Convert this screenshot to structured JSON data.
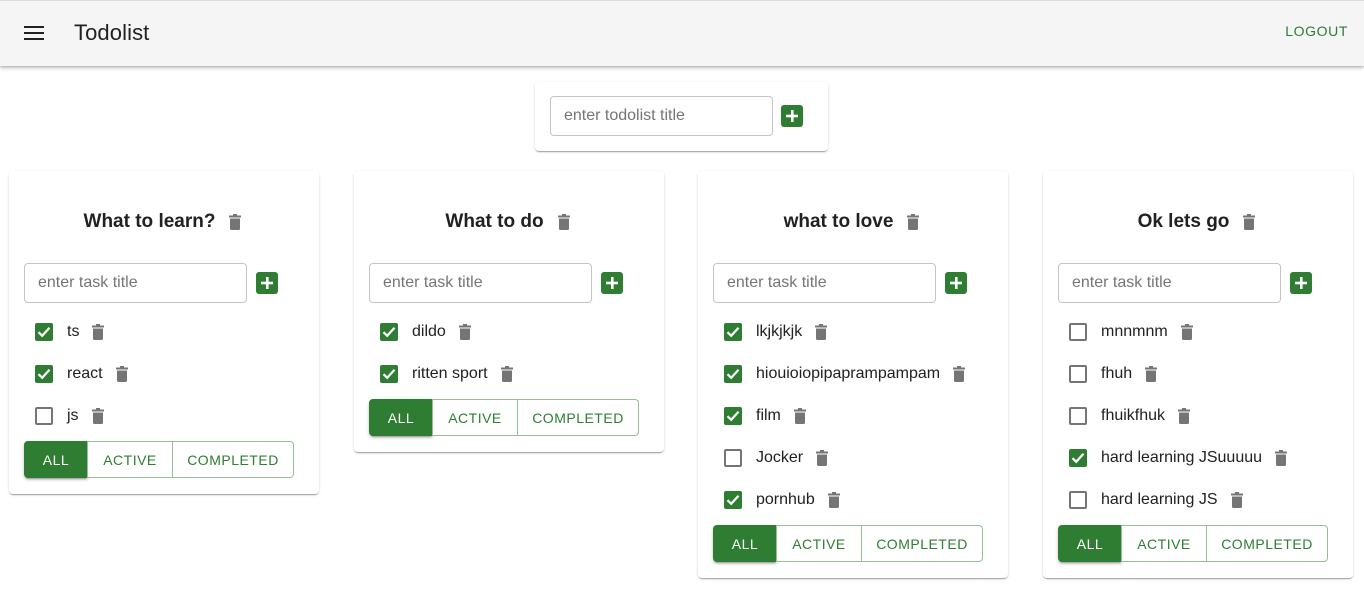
{
  "header": {
    "title": "Todolist",
    "logout_label": "LOGOUT"
  },
  "add_todolist": {
    "placeholder": "enter todolist title"
  },
  "colors": {
    "accent": "#2e7d32",
    "appbar_bg": "#f5f5f5"
  },
  "todolists": [
    {
      "title": "What to learn?",
      "task_placeholder": "enter task title",
      "tasks": [
        {
          "title": "ts",
          "done": true
        },
        {
          "title": "react",
          "done": true
        },
        {
          "title": "js",
          "done": false
        }
      ],
      "filters": [
        "ALL",
        "ACTIVE",
        "COMPLETED"
      ],
      "active_filter": "ALL"
    },
    {
      "title": "What to do",
      "task_placeholder": "enter task title",
      "tasks": [
        {
          "title": "dildo",
          "done": true
        },
        {
          "title": "ritten sport",
          "done": true
        }
      ],
      "filters": [
        "ALL",
        "ACTIVE",
        "COMPLETED"
      ],
      "active_filter": "ALL"
    },
    {
      "title": "what to love",
      "task_placeholder": "enter task title",
      "tasks": [
        {
          "title": "lkjkjkjk",
          "done": true
        },
        {
          "title": "hiouioiopipaprampampam",
          "done": true
        },
        {
          "title": "film",
          "done": true
        },
        {
          "title": "Jocker",
          "done": false
        },
        {
          "title": "pornhub",
          "done": true
        }
      ],
      "filters": [
        "ALL",
        "ACTIVE",
        "COMPLETED"
      ],
      "active_filter": "ALL"
    },
    {
      "title": "Ok lets go",
      "task_placeholder": "enter task title",
      "tasks": [
        {
          "title": "mnnmnm",
          "done": false
        },
        {
          "title": "fhuh",
          "done": false
        },
        {
          "title": "fhuikfhuk",
          "done": false
        },
        {
          "title": "hard learning JSuuuuu",
          "done": true
        },
        {
          "title": "hard learning JS",
          "done": false
        }
      ],
      "filters": [
        "ALL",
        "ACTIVE",
        "COMPLETED"
      ],
      "active_filter": "ALL"
    }
  ]
}
